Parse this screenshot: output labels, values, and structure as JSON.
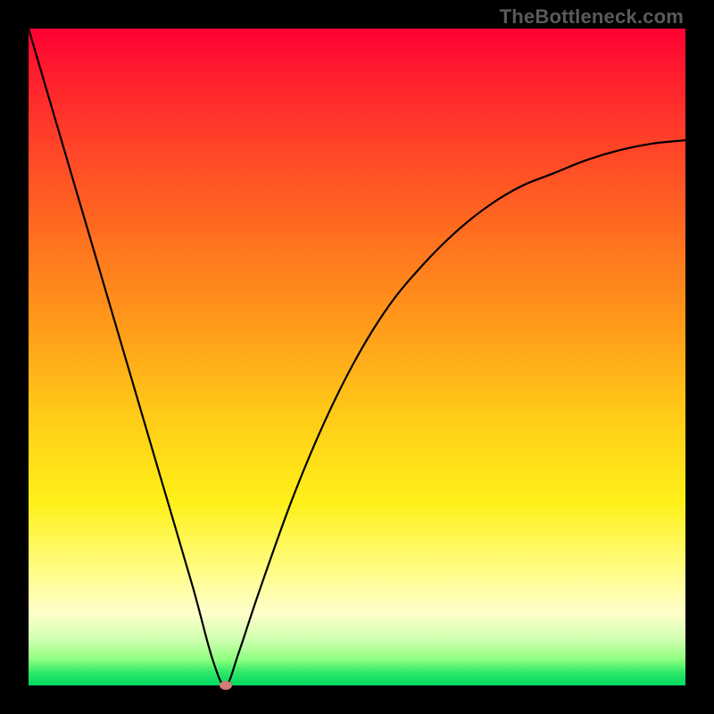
{
  "watermark": "TheBottleneck.com",
  "chart_data": {
    "type": "line",
    "title": "",
    "xlabel": "",
    "ylabel": "",
    "xlim": [
      0,
      100
    ],
    "ylim": [
      0,
      100
    ],
    "grid": false,
    "series": [
      {
        "name": "bottleneck-curve",
        "x": [
          0,
          5,
          10,
          15,
          20,
          25,
          28,
          30,
          32,
          35,
          40,
          45,
          50,
          55,
          60,
          65,
          70,
          75,
          80,
          85,
          90,
          95,
          100
        ],
        "y": [
          100,
          83,
          66,
          49,
          32,
          15,
          4,
          0,
          5,
          14,
          28,
          40,
          50,
          58,
          64,
          69,
          73,
          76,
          78,
          80,
          81.5,
          82.5,
          83
        ]
      }
    ],
    "annotations": [
      {
        "type": "point",
        "name": "minimum-marker",
        "x": 30,
        "y": 0
      }
    ]
  },
  "colors": {
    "curve": "#000000",
    "marker": "#d87a7a",
    "frame": "#000000"
  }
}
